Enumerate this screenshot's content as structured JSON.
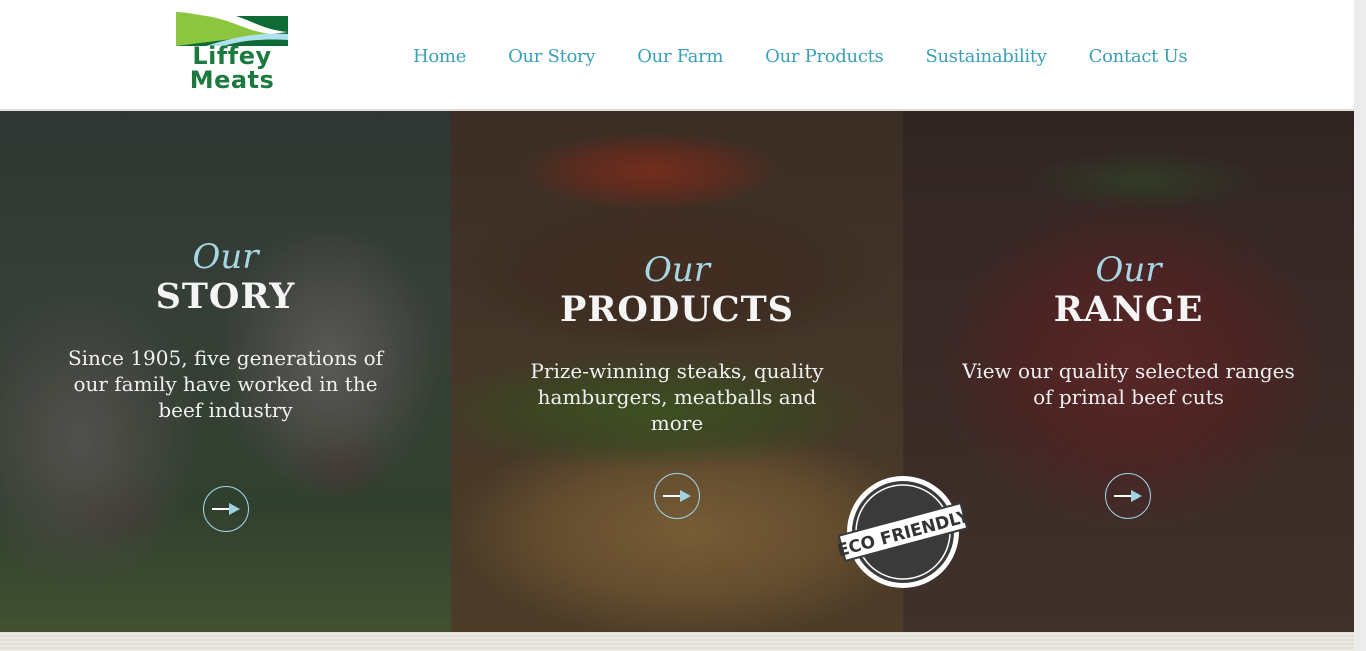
{
  "brand": {
    "line1": "Liffey",
    "line2": "Meats"
  },
  "nav": {
    "items": [
      {
        "label": "Home"
      },
      {
        "label": "Our Story"
      },
      {
        "label": "Our Farm"
      },
      {
        "label": "Our Products"
      },
      {
        "label": "Sustainability"
      },
      {
        "label": "Contact Us"
      }
    ]
  },
  "panels": [
    {
      "eyebrow": "Our",
      "heading": "STORY",
      "description": "Since 1905, five generations of our family have worked in the beef industry",
      "icon": "arrow-right-icon"
    },
    {
      "eyebrow": "Our",
      "heading": "PRODUCTS",
      "description": "Prize-winning steaks, quality hamburgers, meatballs and more",
      "icon": "arrow-right-icon"
    },
    {
      "eyebrow": "Our",
      "heading": "RANGE",
      "description": "View our quality selected ranges of primal beef cuts",
      "icon": "arrow-right-icon"
    }
  ],
  "badge": {
    "text": "ECO FRIENDLY"
  },
  "colors": {
    "nav": "#3aa0b8",
    "accent": "#9fd3e3",
    "brand_green": "#1c7a3e"
  }
}
